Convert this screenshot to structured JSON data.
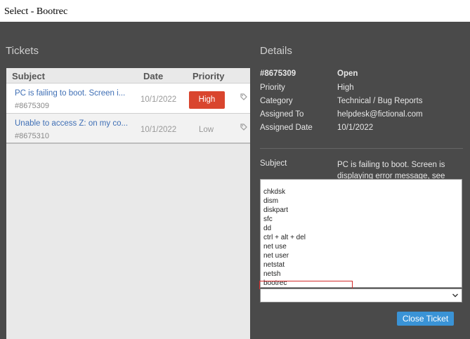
{
  "instruction": "Select - Bootrec",
  "sections": {
    "tickets_title": "Tickets",
    "details_title": "Details"
  },
  "ticket_list": {
    "headers": {
      "subject": "Subject",
      "date": "Date",
      "priority": "Priority"
    },
    "rows": [
      {
        "subject": "PC is failing to boot. Screen i...",
        "id": "#8675309",
        "date": "10/1/2022",
        "priority": "High"
      },
      {
        "subject": "Unable to access Z: on my co...",
        "id": "#8675310",
        "date": "10/1/2022",
        "priority": "Low"
      }
    ]
  },
  "details": {
    "id": "#8675309",
    "status": "Open",
    "fields": [
      {
        "label": "Priority",
        "value": "High"
      },
      {
        "label": "Category",
        "value": "Technical / Bug Reports"
      },
      {
        "label": "Assigned To",
        "value": "helpdesk@fictional.com"
      },
      {
        "label": "Assigned Date",
        "value": "10/1/2022"
      }
    ],
    "subject_label": "Subject",
    "subject_text": "PC is failing to boot. Screen is displaying error message, see"
  },
  "dropdown": {
    "options": [
      "chkdsk",
      "dism",
      "diskpart",
      "sfc",
      "dd",
      "ctrl + alt + del",
      "net use",
      "net user",
      "netstat",
      "netsh",
      "bootrec"
    ],
    "selected": ""
  },
  "buttons": {
    "close_ticket": "Close Ticket"
  },
  "colors": {
    "accent": "#3a93d6",
    "high_priority": "#d9452e",
    "highlight": "#d22b2b",
    "background": "#4a4a4a"
  }
}
